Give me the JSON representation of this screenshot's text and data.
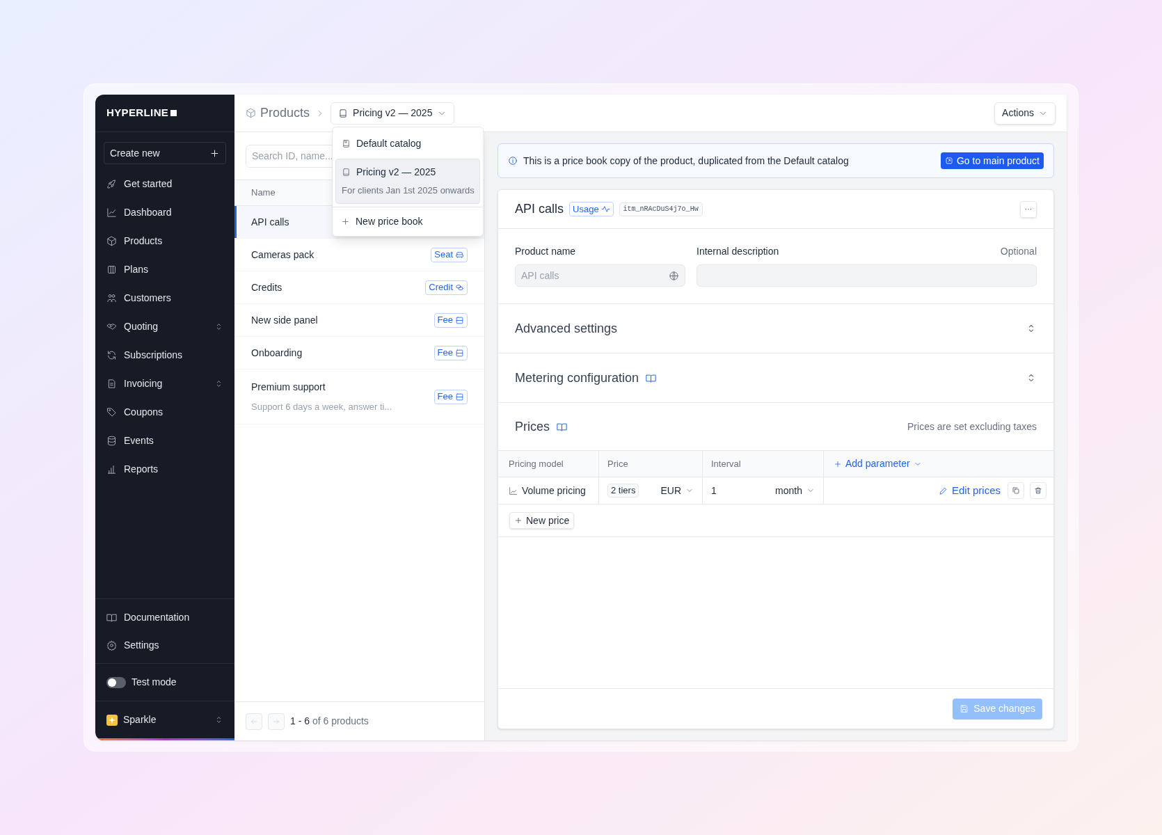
{
  "sidebar": {
    "logo": "HYPERLINE",
    "create_button": "Create new",
    "items": [
      {
        "label": "Get started",
        "expandable": false
      },
      {
        "label": "Dashboard",
        "expandable": false
      },
      {
        "label": "Products",
        "expandable": false
      },
      {
        "label": "Plans",
        "expandable": false
      },
      {
        "label": "Customers",
        "expandable": false
      },
      {
        "label": "Quoting",
        "expandable": true
      },
      {
        "label": "Subscriptions",
        "expandable": false
      },
      {
        "label": "Invoicing",
        "expandable": true
      },
      {
        "label": "Coupons",
        "expandable": false
      },
      {
        "label": "Events",
        "expandable": false
      },
      {
        "label": "Reports",
        "expandable": false
      }
    ],
    "footer_items": [
      {
        "label": "Documentation"
      },
      {
        "label": "Settings"
      }
    ],
    "test_mode": {
      "label": "Test mode",
      "on": false
    },
    "workspace": {
      "name": "Sparkle"
    }
  },
  "breadcrumb": {
    "root": "Products",
    "price_book": "Pricing v2 — 2025"
  },
  "actions_button": "Actions",
  "price_book_menu": {
    "items": [
      {
        "label": "Default catalog",
        "selected": false
      },
      {
        "label": "Pricing v2 — 2025",
        "description": "For clients Jan 1st 2025 onwards",
        "selected": true
      }
    ],
    "new_button": "New price book"
  },
  "product_list": {
    "search_placeholder": "Search ID, name...",
    "column": "Name",
    "rows": [
      {
        "name": "API calls",
        "selected": true
      },
      {
        "name": "Cameras pack",
        "type": {
          "label": "Seat",
          "kind": "seat"
        },
        "selected": false
      },
      {
        "name": "Credits",
        "type": {
          "label": "Credit",
          "kind": "credit"
        },
        "selected": false
      },
      {
        "name": "New side panel",
        "type": {
          "label": "Fee",
          "kind": "fee"
        },
        "selected": false
      },
      {
        "name": "Onboarding",
        "type": {
          "label": "Fee",
          "kind": "fee"
        },
        "selected": false
      },
      {
        "name": "Premium support",
        "description": "Support 6 days a week, answer ti...",
        "type": {
          "label": "Fee",
          "kind": "fee"
        },
        "selected": false
      }
    ],
    "pagination": {
      "range": "1 - 6",
      "total": "of 6 products"
    }
  },
  "notice": {
    "text": "This is a price book copy of the product, duplicated from the Default catalog",
    "button": "Go to main product"
  },
  "product": {
    "title": "API calls",
    "type": {
      "label": "Usage",
      "kind": "usage"
    },
    "id": "itm_nRAcDuS4j7o_Hw",
    "more_button": "···",
    "fields": [
      {
        "label": "Product name",
        "value": "API calls"
      },
      {
        "label": "Internal description",
        "hint": "Optional"
      }
    ],
    "sections": [
      {
        "title": "Advanced settings",
        "doc_link": false
      },
      {
        "title": "Metering configuration",
        "doc_link": true
      }
    ],
    "prices": {
      "title": "Prices",
      "note": "Prices are set excluding taxes",
      "columns": [
        "Pricing model",
        "Price",
        "Interval"
      ],
      "add_parameter": "Add parameter",
      "rows": [
        {
          "model": "Volume pricing",
          "tiers": "2 tiers",
          "currency": "EUR",
          "interval_count": "1",
          "interval_unit": "month",
          "edit": "Edit prices"
        }
      ],
      "new_price": "New price"
    },
    "save_button": {
      "label": "Save changes",
      "disabled": true
    }
  }
}
